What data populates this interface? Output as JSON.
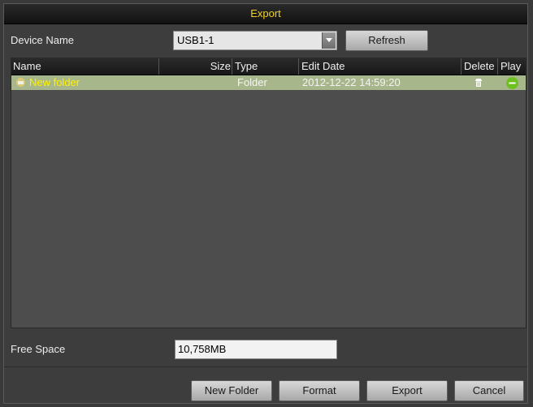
{
  "dialog": {
    "title": "Export"
  },
  "device": {
    "label": "Device Name",
    "value": "USB1-1",
    "refresh_label": "Refresh"
  },
  "table": {
    "columns": {
      "name": "Name",
      "size": "Size",
      "type": "Type",
      "edit_date": "Edit Date",
      "delete": "Delete",
      "play": "Play"
    },
    "rows": [
      {
        "name": "New folder",
        "size": "",
        "type": "Folder",
        "edit_date": "2012-12-22 14:59:20",
        "icon": "folder-icon",
        "delete_icon": "trash-icon",
        "play_icon": "minus-icon"
      }
    ]
  },
  "free_space": {
    "label": "Free Space",
    "value": "10,758MB"
  },
  "buttons": {
    "new_folder": "New Folder",
    "format": "Format",
    "export": "Export",
    "cancel": "Cancel"
  },
  "colors": {
    "title_text": "#f0d020",
    "selected_row": "#a8b68c",
    "selected_name": "#fff200",
    "play_icon": "#6ec020"
  }
}
